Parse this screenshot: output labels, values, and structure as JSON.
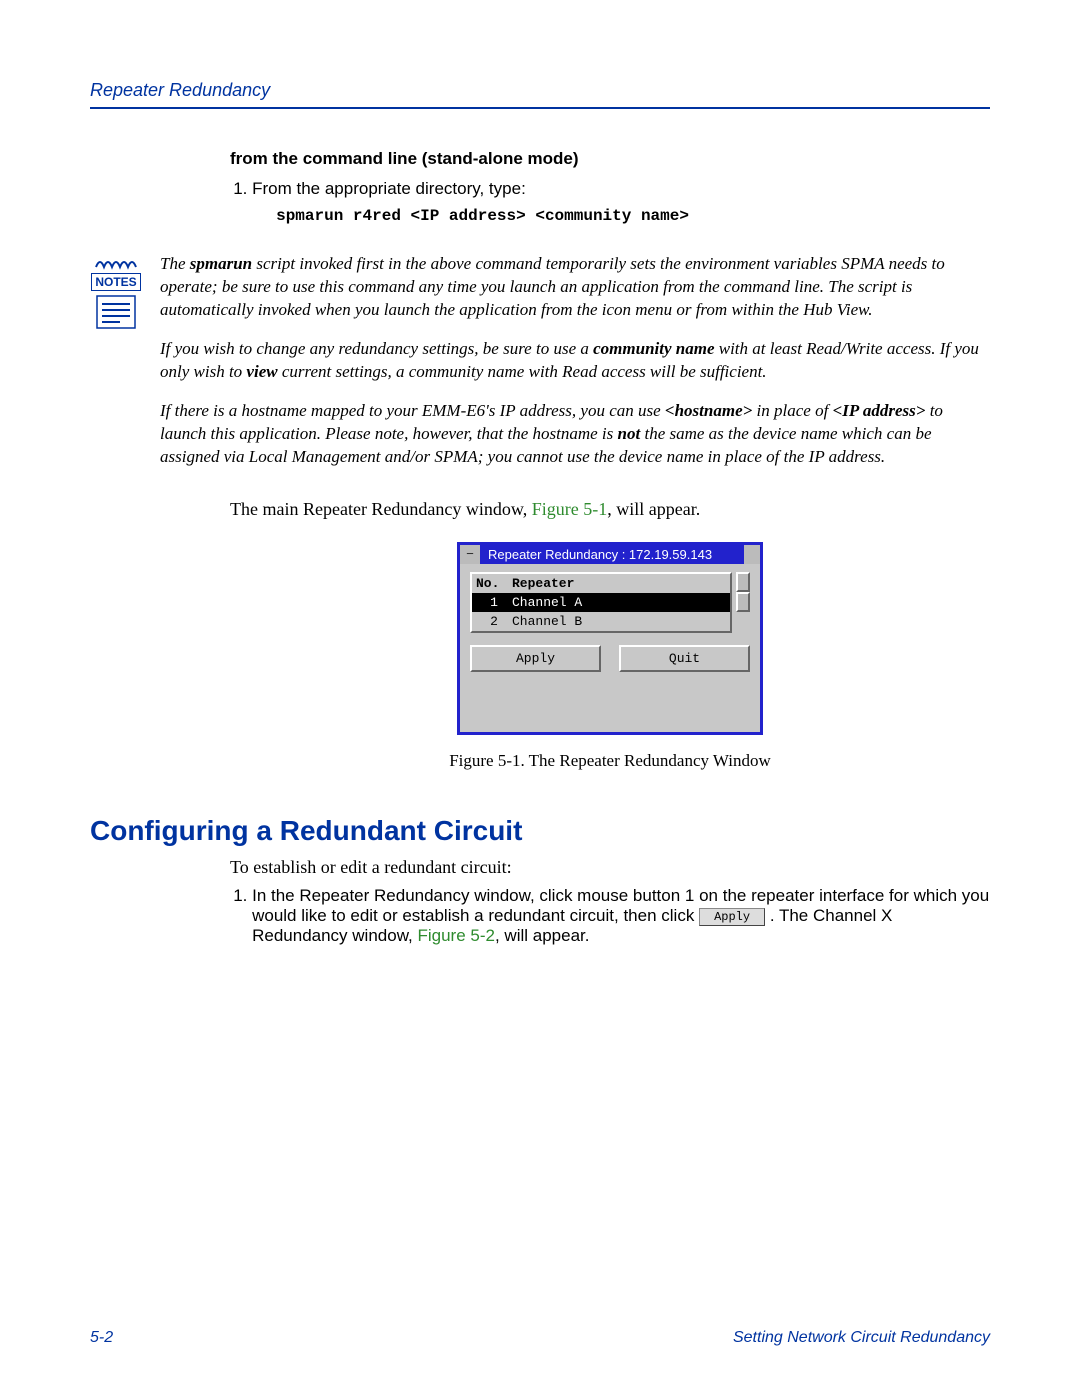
{
  "header": {
    "title": "Repeater Redundancy"
  },
  "section1": {
    "subhead": "from the command line (stand-alone mode)",
    "step1": "From the appropriate directory, type:",
    "command": "spmarun r4red <IP address> <community name>"
  },
  "notes": {
    "label": "NOTES",
    "p1a": "The ",
    "p1b": "spmarun",
    "p1c": " script invoked first in the above command temporarily sets the environment variables SPMA needs to operate; be sure to use this command any time you launch an application from the command line. The script is automatically invoked when you launch the application from the icon menu or from within the Hub View.",
    "p2a": "If you wish to change any redundancy settings, be sure to use a ",
    "p2b": "community name",
    "p2c": " with at least Read/Write access. If you only wish to ",
    "p2d": "view",
    "p2e": " current settings, a community name with Read access will be sufficient.",
    "p3a": "If there is a hostname mapped to your EMM-E6's IP address, you can use ",
    "p3b": "<hostname>",
    "p3c": " in place of ",
    "p3d": "<IP address>",
    "p3e": " to launch this application. Please note, however, that the hostname is ",
    "p3f": "not",
    "p3g": " the same as the device name which can be assigned via Local Management and/or SPMA; you cannot use the device name in place of the IP address."
  },
  "after_notes": {
    "pre": "The main Repeater Redundancy window, ",
    "figref": "Figure 5-1",
    "post": ", will appear."
  },
  "window": {
    "title": "Repeater Redundancy : 172.19.59.143",
    "sysbox": "−",
    "col_no": "No.",
    "col_rep": "Repeater",
    "rows": [
      {
        "no": "1",
        "name": "Channel A",
        "selected": true
      },
      {
        "no": "2",
        "name": "Channel B",
        "selected": false
      }
    ],
    "apply": "Apply",
    "quit": "Quit"
  },
  "caption": "Figure 5-1. The Repeater Redundancy Window",
  "section2": {
    "heading": "Configuring a Redundant Circuit",
    "intro": "To establish or edit a redundant circuit:",
    "li1a": "In the Repeater Redundancy window, click mouse button 1 on the repeater interface for which you would like to edit or establish a redundant circuit, then click ",
    "li1_btn": "Apply",
    "li1b": ". The Channel X Redundancy window, ",
    "li1_fig": "Figure 5-2",
    "li1c": ", will appear."
  },
  "footer": {
    "left": "5-2",
    "right": "Setting Network Circuit Redundancy"
  }
}
